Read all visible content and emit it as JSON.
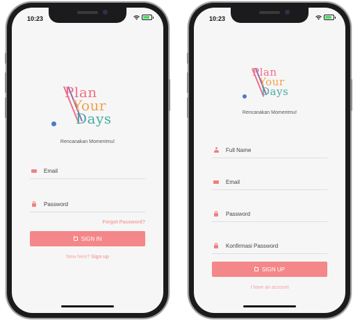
{
  "login": {
    "status_time": "10:23",
    "logo": {
      "line1": "Plan",
      "line2": "Your",
      "line3": "Days"
    },
    "tagline": "Rencanakan Momentmu!",
    "email_placeholder": "Email",
    "password_placeholder": "Password",
    "forgot_link": "Forgot Password?",
    "sign_in_label": "SIGN IN",
    "new_here_text": "New here?",
    "sign_up_link": "Sign up"
  },
  "signup": {
    "status_time": "10:23",
    "logo": {
      "line1": "Plan",
      "line2": "Your",
      "line3": "Days"
    },
    "tagline": "Rencanakan Momentmu!",
    "fullname_placeholder": "Full Name",
    "email_placeholder": "Email",
    "password_placeholder": "Password",
    "confirm_password_placeholder": "Konfirmasi Password",
    "sign_up_label": "SIGN UP",
    "have_account_link": "I have an account"
  },
  "colors": {
    "accent": "#f48789",
    "accent_light": "#f3a3a3",
    "logo_pink": "#ee6f85",
    "logo_orange": "#f3a04a",
    "logo_teal": "#49a9a3",
    "logo_dot": "#4a7bc6"
  },
  "icons": [
    "wifi-icon",
    "battery-icon",
    "mail-icon",
    "lock-icon",
    "user-icon",
    "enter-icon"
  ]
}
